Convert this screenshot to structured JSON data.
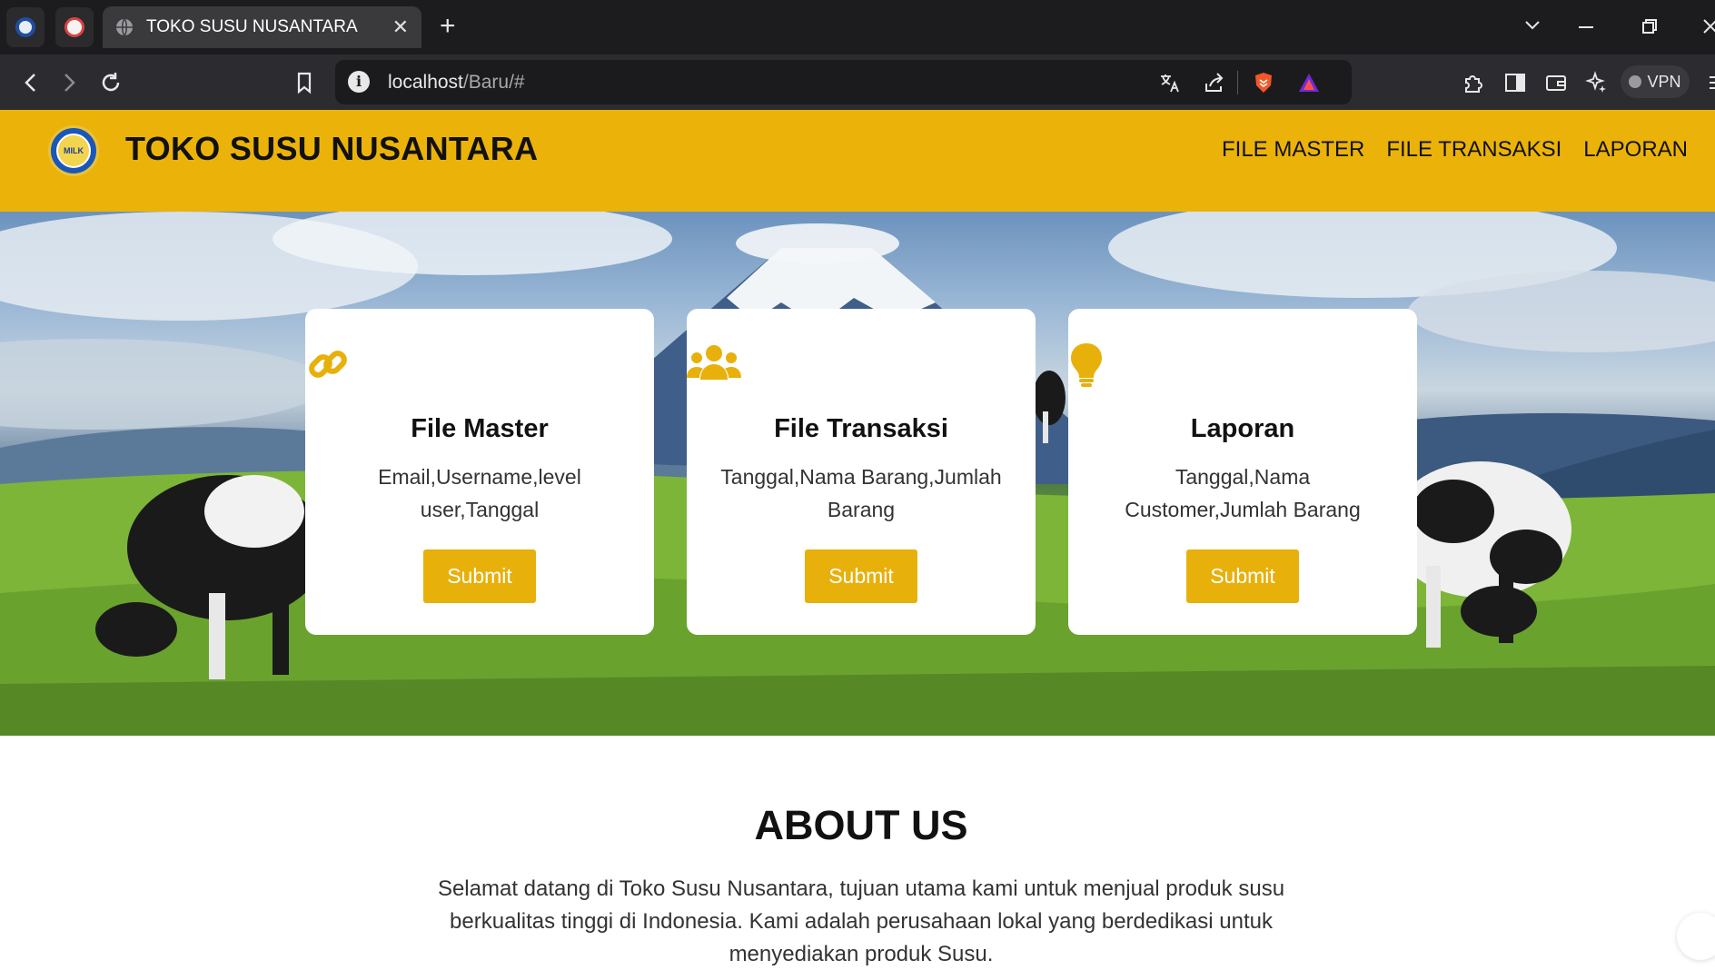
{
  "browser": {
    "tab_title": "TOKO SUSU NUSANTARA",
    "close_glyph": "✕",
    "newtab_glyph": "+",
    "url_host": "localhost",
    "url_path": "/Baru/#",
    "vpn_label": "VPN",
    "icons": [
      "back-icon",
      "forward-icon",
      "reload-icon",
      "bookmark-icon",
      "site-info-icon",
      "translate-icon",
      "share-icon",
      "brave-shield-icon",
      "brave-rewards-icon",
      "extensions-icon",
      "sidebar-icon",
      "wallet-icon",
      "leo-ai-icon",
      "menu-icon"
    ]
  },
  "site": {
    "brand": "TOKO SUSU NUSANTARA",
    "logo_text": "MILK",
    "nav": [
      "FILE MASTER",
      "FILE TRANSAKSI",
      "LAPORAN"
    ],
    "accent_color": "#ebb309"
  },
  "cards": [
    {
      "icon": "link-icon",
      "title": "File Master",
      "desc": "Email,Username,level user,Tanggal",
      "button": "Submit"
    },
    {
      "icon": "users-icon",
      "title": "File Transaksi",
      "desc": "Tanggal,Nama Barang,Jumlah Barang",
      "button": "Submit"
    },
    {
      "icon": "lightbulb-icon",
      "title": "Laporan",
      "desc": "Tanggal,Nama Customer,Jumlah Barang",
      "button": "Submit"
    }
  ],
  "about": {
    "title": "ABOUT US",
    "text": "Selamat datang di Toko Susu Nusantara, tujuan utama kami untuk menjual produk susu berkualitas tinggi di Indonesia. Kami adalah perusahaan lokal yang berdedikasi untuk menyediakan produk Susu."
  }
}
